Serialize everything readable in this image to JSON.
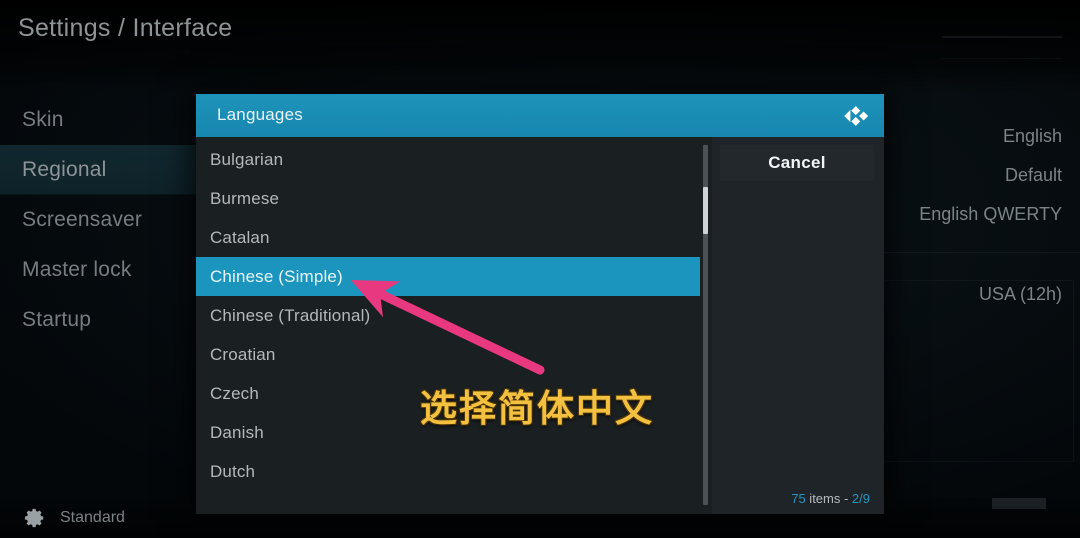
{
  "app": {
    "page_title": "Settings / Interface"
  },
  "sidebar": {
    "items": [
      {
        "label": "Skin",
        "selected": false
      },
      {
        "label": "Regional",
        "selected": true
      },
      {
        "label": "Screensaver",
        "selected": false
      },
      {
        "label": "Master lock",
        "selected": false
      },
      {
        "label": "Startup",
        "selected": false
      }
    ]
  },
  "settings_values": {
    "rows": [
      "English",
      "Default",
      "English QWERTY"
    ],
    "row_after_divider": "USA (12h)"
  },
  "status_bar": {
    "gear_icon": "gear-icon",
    "label": "Standard"
  },
  "dialog": {
    "title": "Languages",
    "logo_icon": "kodi-logo-icon",
    "languages": [
      {
        "label": "Bulgarian",
        "selected": false
      },
      {
        "label": "Burmese",
        "selected": false
      },
      {
        "label": "Catalan",
        "selected": false
      },
      {
        "label": "Chinese (Simple)",
        "selected": true
      },
      {
        "label": "Chinese (Traditional)",
        "selected": false
      },
      {
        "label": "Croatian",
        "selected": false
      },
      {
        "label": "Czech",
        "selected": false
      },
      {
        "label": "Danish",
        "selected": false
      },
      {
        "label": "Dutch",
        "selected": false
      }
    ],
    "cancel_label": "Cancel",
    "items_count": {
      "total": "75",
      "middle": " items - ",
      "page": "2/9"
    }
  },
  "annotation": {
    "text": "选择简体中文",
    "arrow_color": "#e8387f",
    "text_color": "#f3c13f"
  },
  "colors": {
    "accent": "#1b95bd",
    "header": "#1787ae",
    "dialog_bg": "#1a1f22",
    "count_blue": "#2b93c0"
  }
}
